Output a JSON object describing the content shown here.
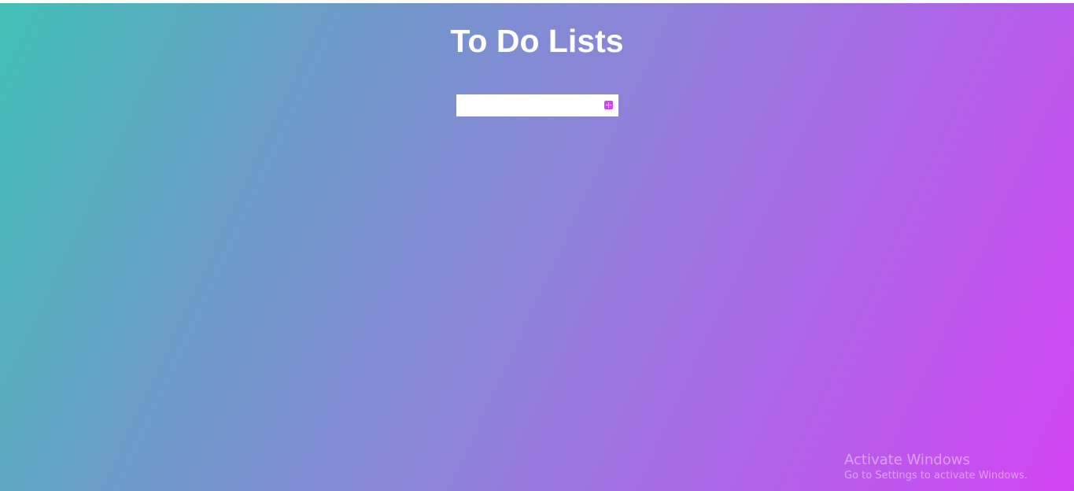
{
  "page": {
    "title": "To Do Lists"
  },
  "todo_input": {
    "value": "",
    "placeholder": ""
  },
  "add_button": {
    "icon": "plus-icon",
    "color": "#c64ee8"
  },
  "watermark": {
    "title": "Activate Windows",
    "subtitle": "Go to Settings to activate Windows."
  },
  "colors": {
    "gradient_start": "#41c1b6",
    "gradient_end": "#d244f3",
    "title_text": "#ffffff"
  }
}
